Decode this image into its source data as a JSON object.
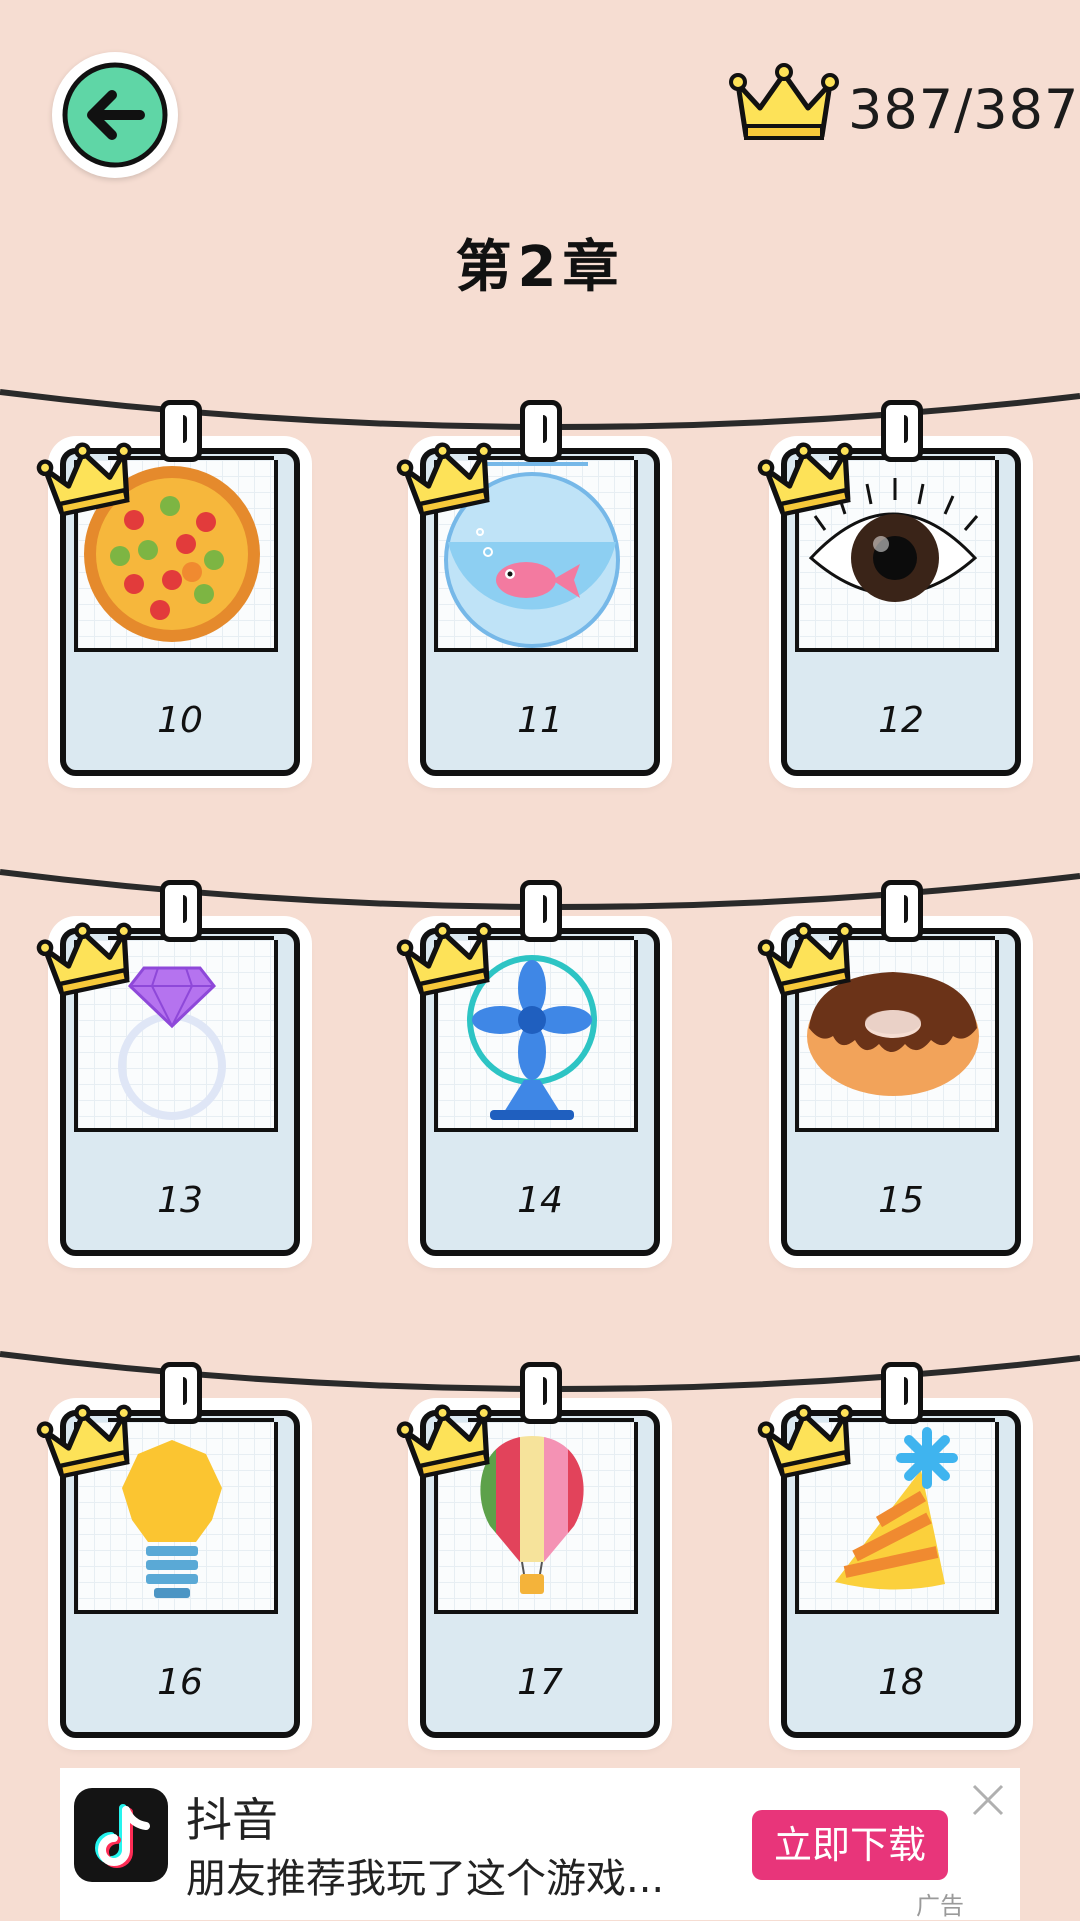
{
  "header": {
    "back_icon": "arrow-left-icon",
    "score_icon": "crown-icon",
    "score": "387/387",
    "chapter_title": "第2章"
  },
  "colors": {
    "background": "#f6ddd2",
    "back_button": "#5fd6a6",
    "crown": "#fde258",
    "card": "#dbe9f1",
    "ad_button": "#e8357a"
  },
  "levels": [
    {
      "number": "10",
      "icon": "pizza-icon",
      "crown": true
    },
    {
      "number": "11",
      "icon": "fishbowl-icon",
      "crown": true
    },
    {
      "number": "12",
      "icon": "eye-icon",
      "crown": true
    },
    {
      "number": "13",
      "icon": "diamond-ring-icon",
      "crown": true
    },
    {
      "number": "14",
      "icon": "electric-fan-icon",
      "crown": true
    },
    {
      "number": "15",
      "icon": "donut-icon",
      "crown": true
    },
    {
      "number": "16",
      "icon": "lightbulb-icon",
      "crown": true
    },
    {
      "number": "17",
      "icon": "hot-air-balloon-icon",
      "crown": true
    },
    {
      "number": "18",
      "icon": "party-hat-icon",
      "crown": true
    }
  ],
  "ad": {
    "app_icon": "tiktok-icon",
    "title": "抖音",
    "description": "朋友推荐我玩了这个游戏...",
    "button": "立即下载",
    "close_icon": "close-icon",
    "tag": "广告"
  }
}
